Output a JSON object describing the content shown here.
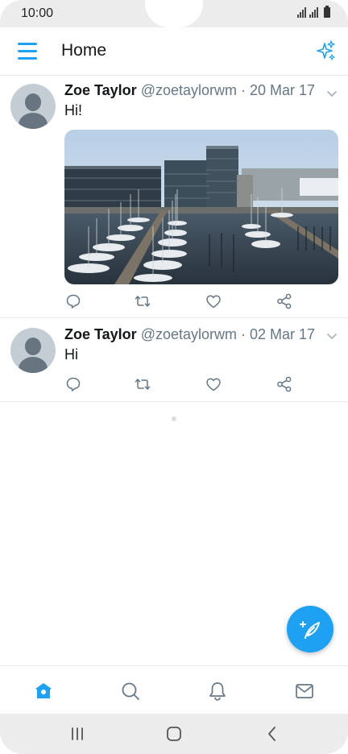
{
  "status_bar": {
    "time": "10:00"
  },
  "app_bar": {
    "title": "Home"
  },
  "tweets": [
    {
      "name": "Zoe Taylor",
      "handle": "@zoetaylorwm",
      "separator": " · ",
      "date": "20 Mar 17",
      "text": "Hi!",
      "has_image": true,
      "image_alt": "Harbor marina with sailboats and modern office buildings"
    },
    {
      "name": "Zoe Taylor",
      "handle": "@zoetaylorwm",
      "separator": " · ",
      "date": "02 Mar 17",
      "text": "Hi",
      "has_image": false
    }
  ],
  "icons": {
    "menu": "menu-icon",
    "sparkle": "sparkle-icon",
    "reply": "reply-icon",
    "retweet": "retweet-icon",
    "like": "heart-icon",
    "share": "share-icon",
    "compose": "compose-tweet-icon",
    "home": "home-icon",
    "search": "search-icon",
    "notifications": "bell-icon",
    "messages": "mail-icon"
  },
  "colors": {
    "accent": "#1da1f2",
    "text": "#14171a",
    "secondary": "#657786",
    "icon_gray": "#657786"
  }
}
